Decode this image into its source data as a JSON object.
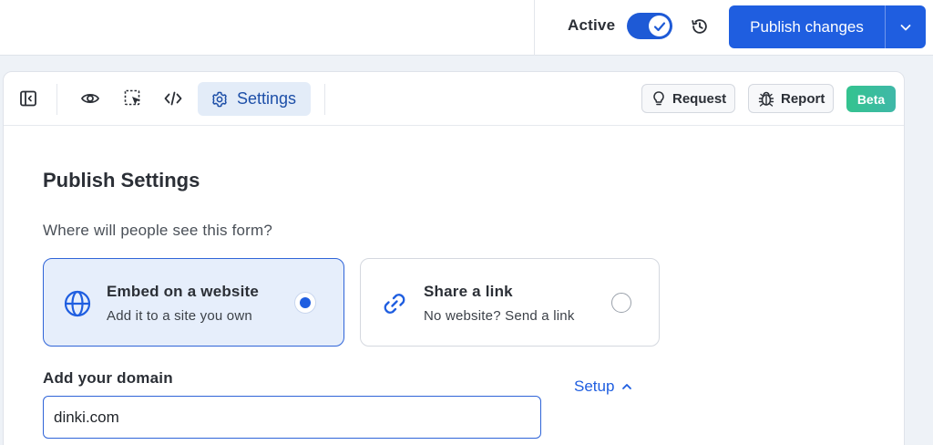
{
  "header": {
    "active_label": "Active",
    "active_on": true,
    "publish_label": "Publish changes"
  },
  "toolbar": {
    "settings_label": "Settings",
    "request_label": "Request",
    "report_label": "Report",
    "beta_label": "Beta"
  },
  "content": {
    "title": "Publish Settings",
    "question": "Where will people see this form?",
    "options": [
      {
        "title": "Embed on a website",
        "subtitle": "Add it to a site you own",
        "selected": true,
        "icon": "globe-icon"
      },
      {
        "title": "Share a link",
        "subtitle": "No website? Send a link",
        "selected": false,
        "icon": "link-icon"
      }
    ],
    "domain_label": "Add your domain",
    "setup_label": "Setup",
    "domain_value": "dinki.com"
  },
  "colors": {
    "accent": "#1f5ee0",
    "selected_bg": "#e6eefb",
    "beta_start": "#34c38f",
    "beta_end": "#3fb8a8"
  }
}
